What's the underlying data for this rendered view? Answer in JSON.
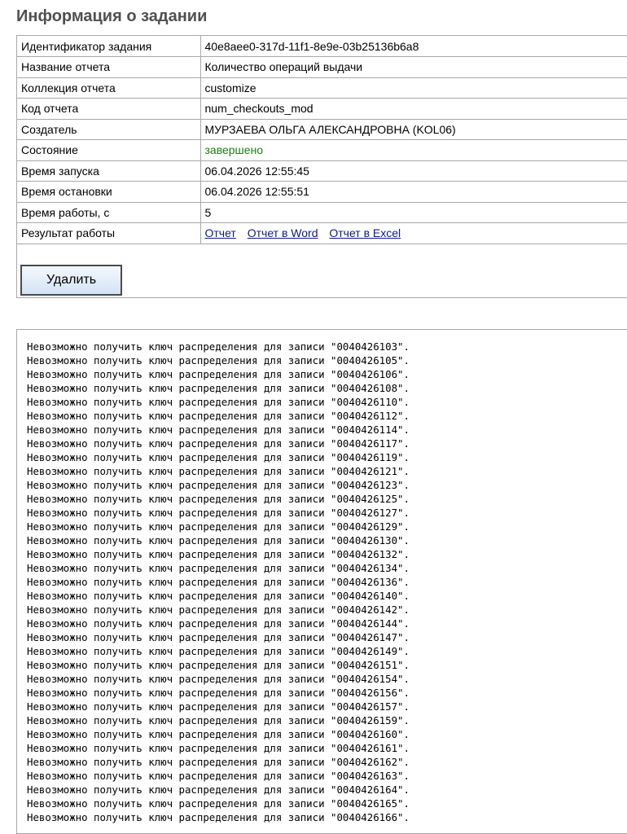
{
  "page_title": "Информация о задании",
  "task_info": {
    "rows": [
      {
        "label": "Идентификатор задания",
        "value": "40e8aee0-317d-11f1-8e9e-03b25136b6a8"
      },
      {
        "label": "Название отчета",
        "value": "Количество операций выдачи"
      },
      {
        "label": "Коллекция отчета",
        "value": "customize"
      },
      {
        "label": "Код отчета",
        "value": "num_checkouts_mod"
      },
      {
        "label": "Создатель",
        "value": "МУРЗАЕВА ОЛЬГА АЛЕКСАНДРОВНА (KOL06)"
      },
      {
        "label": "Состояние",
        "value": "завершено",
        "status_color": "#1a7f1a"
      },
      {
        "label": "Время запуска",
        "value": "06.04.2026 12:55:45"
      },
      {
        "label": "Время остановки",
        "value": "06.04.2026 12:55:51"
      },
      {
        "label": "Время работы, с",
        "value": "5"
      }
    ],
    "result": {
      "label": "Результат работы",
      "links": [
        "Отчет",
        "Отчет в Word",
        "Отчет в Excel"
      ]
    }
  },
  "actions": {
    "delete_label": "Удалить"
  },
  "log": {
    "message_prefix": "Невозможно получить ключ распределения для записи",
    "record_ids": [
      "0040426103",
      "0040426105",
      "0040426106",
      "0040426108",
      "0040426110",
      "0040426112",
      "0040426114",
      "0040426117",
      "0040426119",
      "0040426121",
      "0040426123",
      "0040426125",
      "0040426127",
      "0040426129",
      "0040426130",
      "0040426132",
      "0040426134",
      "0040426136",
      "0040426140",
      "0040426142",
      "0040426144",
      "0040426147",
      "0040426149",
      "0040426151",
      "0040426154",
      "0040426156",
      "0040426157",
      "0040426159",
      "0040426160",
      "0040426161",
      "0040426162",
      "0040426163",
      "0040426164",
      "0040426165",
      "0040426166"
    ]
  }
}
